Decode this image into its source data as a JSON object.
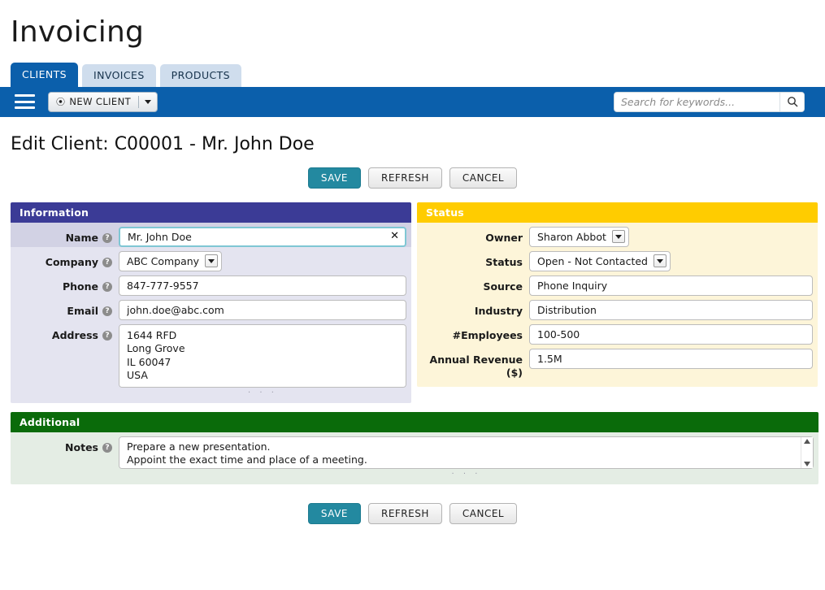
{
  "app": {
    "title": "Invoicing"
  },
  "tabs": [
    {
      "label": "CLIENTS",
      "active": true
    },
    {
      "label": "INVOICES",
      "active": false
    },
    {
      "label": "PRODUCTS",
      "active": false
    }
  ],
  "toolbar": {
    "menu_icon": "hamburger-icon",
    "new_button": {
      "label": "NEW CLIENT",
      "plus_icon": "plus-circle-icon",
      "caret_icon": "chevron-down-icon"
    },
    "search": {
      "value": "",
      "placeholder": "Search for keywords...",
      "icon": "search-icon"
    }
  },
  "page": {
    "title": "Edit Client: C00001 - Mr. John Doe"
  },
  "actions": {
    "save": "SAVE",
    "refresh": "REFRESH",
    "cancel": "CANCEL"
  },
  "panels": {
    "information": {
      "title": "Information",
      "header_color": "#3b3b96",
      "fields": {
        "name": {
          "label": "Name",
          "value": "Mr. John Doe",
          "help": "?",
          "focused": true,
          "clear_icon": "close-icon"
        },
        "company": {
          "label": "Company",
          "value": "ABC Company",
          "help": "?",
          "type": "select"
        },
        "phone": {
          "label": "Phone",
          "value": "847-777-9557",
          "help": "?"
        },
        "email": {
          "label": "Email",
          "value": "john.doe@abc.com",
          "help": "?"
        },
        "address": {
          "label": "Address",
          "value": "1644 RFD\nLong Grove\nIL 60047\nUSA",
          "help": "?",
          "type": "textarea"
        }
      }
    },
    "status": {
      "title": "Status",
      "header_color": "#ffcc00",
      "fields": {
        "owner": {
          "label": "Owner",
          "value": "Sharon Abbot",
          "type": "select"
        },
        "status": {
          "label": "Status",
          "value": "Open - Not Contacted",
          "type": "select"
        },
        "source": {
          "label": "Source",
          "value": "Phone Inquiry"
        },
        "industry": {
          "label": "Industry",
          "value": "Distribution"
        },
        "employees": {
          "label": "#Employees",
          "value": "100-500"
        },
        "annual_revenue": {
          "label": "Annual Revenue ($)",
          "value": "1.5M"
        }
      }
    },
    "additional": {
      "title": "Additional",
      "header_color": "#0a6b0a",
      "fields": {
        "notes": {
          "label": "Notes",
          "help": "?",
          "value": "Prepare a new presentation.\nAppoint the exact time and place of a meeting.",
          "type": "textarea"
        }
      }
    }
  },
  "resize_grip": "· · ·"
}
